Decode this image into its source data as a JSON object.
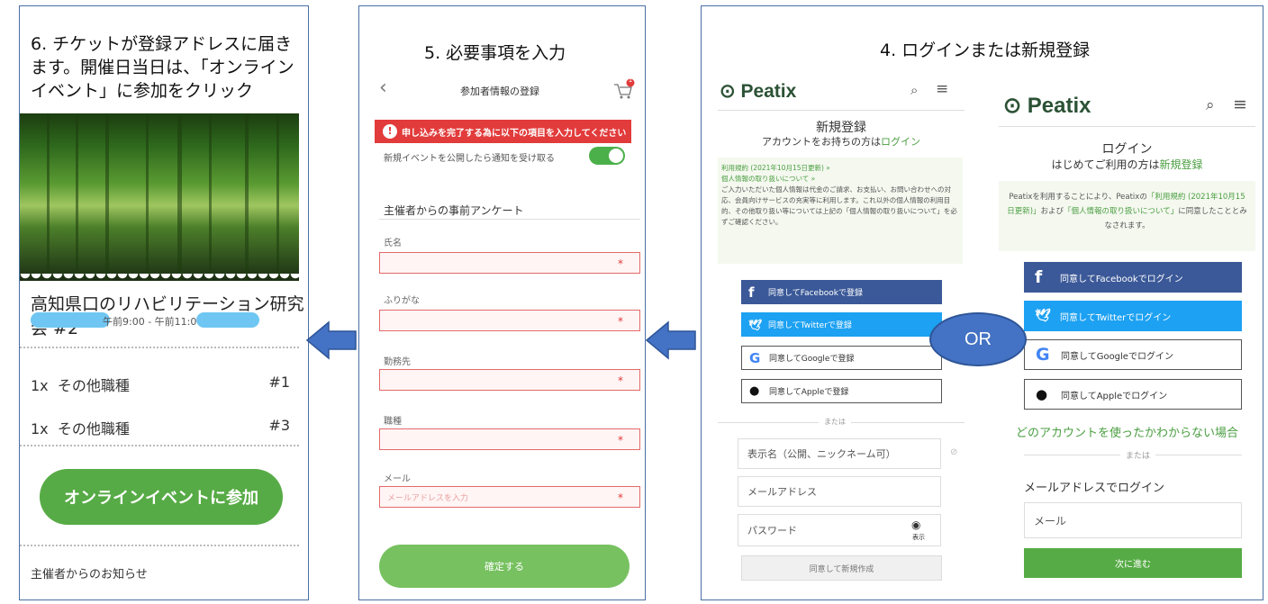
{
  "panel6": {
    "title_line1": "6. チケットが登録アドレスに届き",
    "title_line2": "ます。開催日当日は、「オンライン",
    "title_line3": "イベント」に参加をクリック",
    "event_name": "高知県口のリハビリテーション研究会 #2",
    "event_time": "午前9:00 - 午前11:00 |",
    "tickets": [
      {
        "qty": "1x",
        "name": "その他職種",
        "num": "#1"
      },
      {
        "qty": "1x",
        "name": "その他職種",
        "num": "#3"
      }
    ],
    "join_button": "オンラインイベントに参加",
    "organizer_notice": "主催者からのお知らせ"
  },
  "panel5": {
    "title": "5. 必要事項を入力",
    "header_title": "参加者情報の登録",
    "cart_badge": "1",
    "error_message": "申し込みを完了する為に以下の項目を入力してください",
    "notify_toggle_label": "新規イベントを公開したら通知を受け取る",
    "survey_heading": "主催者からの事前アンケート",
    "fields": [
      {
        "label": "氏名",
        "placeholder": ""
      },
      {
        "label": "ふりがな",
        "placeholder": ""
      },
      {
        "label": "勤務先",
        "placeholder": ""
      },
      {
        "label": "職種",
        "placeholder": ""
      },
      {
        "label": "メール",
        "placeholder": "メールアドレスを入力"
      }
    ],
    "required_mark": "*",
    "confirm_button": "確定する"
  },
  "panel4": {
    "title": "4. ログインまたは新規登録",
    "logo": "Peatix",
    "signup": {
      "heading": "新規登録",
      "subheading_prefix": "アカウントをお持ちの方は",
      "subheading_link": "ログイン",
      "terms_link1": "利用規約 (2021年10月15日更新) »",
      "terms_link2": "個人情報の取り扱いについて »",
      "terms_body": "ご入力いただいた個人情報は代金のご請求、お支払い、お問い合わせへの対応、会員向けサービスの充実等に利用します。これ以外の個人情報の利用目的、その他取り扱い等については上記の「個人情報の取り扱いについて」を必ずご確認ください。",
      "buttons": {
        "facebook": "同意してFacebookで登録",
        "twitter": "同意してTwitterで登録",
        "google": "同意してGoogleで登録",
        "apple": "同意してAppleで登録"
      },
      "or_divider": "または",
      "display_name_placeholder": "表示名（公開、ニックネーム可）",
      "email_placeholder": "メールアドレス",
      "password_placeholder": "パスワード",
      "show_label": "表示",
      "submit": "同意して新規作成"
    },
    "login": {
      "heading": "ログイン",
      "subheading_prefix": "はじめてご利用の方は",
      "subheading_link": "新規登録",
      "terms_part1": "Peatixを利用することにより、Peatixの",
      "terms_link1": "「利用規約 (2021年10月15日更新)」",
      "terms_part2": "および",
      "terms_link2": "「個人情報の取り扱いについて」",
      "terms_part3": "に同意したこととみなされます。",
      "buttons": {
        "facebook": "同意してFacebookでログイン",
        "twitter": "同意してTwitterでログイン",
        "google": "同意してGoogleでログイン",
        "apple": "同意してAppleでログイン"
      },
      "unknown_account": "どのアカウントを使ったかわからない場合",
      "or_divider": "または",
      "email_login_label": "メールアドレスでログイン",
      "email_placeholder": "メール",
      "next_button": "次に進む"
    },
    "or_bubble": "OR"
  },
  "colors": {
    "accent_green": "#57ab46",
    "facebook": "#3b5998",
    "twitter": "#1da1f2",
    "error": "#e23b3b",
    "arrow": "#4472c4"
  }
}
